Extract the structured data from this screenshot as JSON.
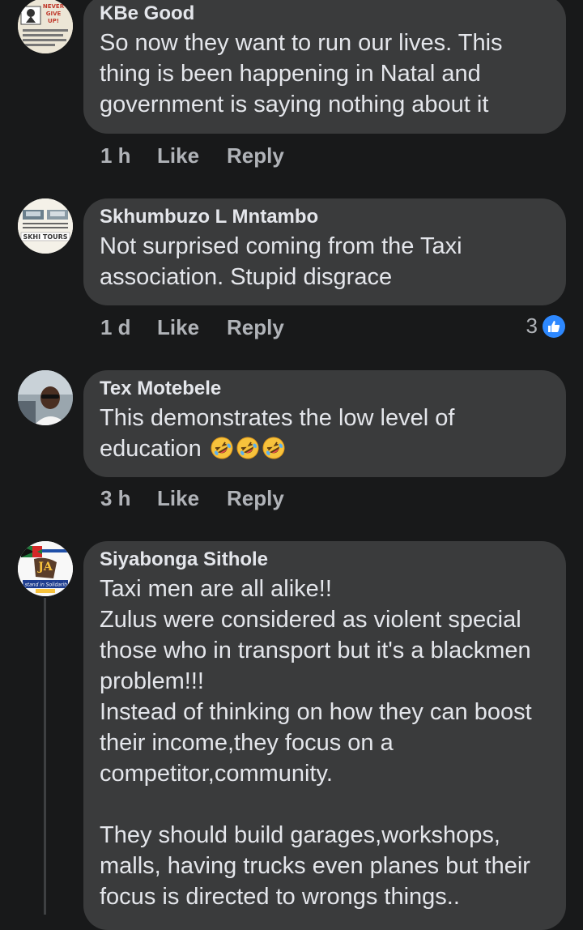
{
  "comments": [
    {
      "author": "KBe Good",
      "text": "So now they want to run our lives. This thing is been happening in Natal and government is saying nothing about it",
      "time": "1 h",
      "like_label": "Like",
      "reply_label": "Reply",
      "avatar_text": [
        "NEVER",
        "GIVE",
        "UP!"
      ]
    },
    {
      "author": "Skhumbuzo L Mntambo",
      "text": "Not surprised coming from the Taxi association. Stupid disgrace",
      "time": "1 d",
      "like_label": "Like",
      "reply_label": "Reply",
      "reaction_count": "3",
      "avatar_text": [
        "SKHI TOURS"
      ]
    },
    {
      "author": "Tex Motebele",
      "text": "This demonstrates the low level of education",
      "emoji": [
        "rolling-on-floor-laughing",
        "rolling-on-floor-laughing",
        "rolling-on-floor-laughing"
      ],
      "time": "3 h",
      "like_label": "Like",
      "reply_label": "Reply"
    },
    {
      "author": "Siyabonga Sithole",
      "text": "Taxi men are all alike!!\nZulus were considered as violent special those who in transport but it's a blackmen problem!!!\nInstead of thinking on how they can boost their income,they focus on a competitor,community.\n\nThey should build garages,workshops, malls, having trucks even planes but their focus is directed to wrongs things..",
      "avatar_text": [
        "I stand in Solidarity"
      ]
    }
  ],
  "colors": {
    "background": "#18191a",
    "bubble": "#3a3b3c",
    "text": "#e4e6eb",
    "meta": "#b0b3b8",
    "like_blue": "#2d88ff"
  }
}
